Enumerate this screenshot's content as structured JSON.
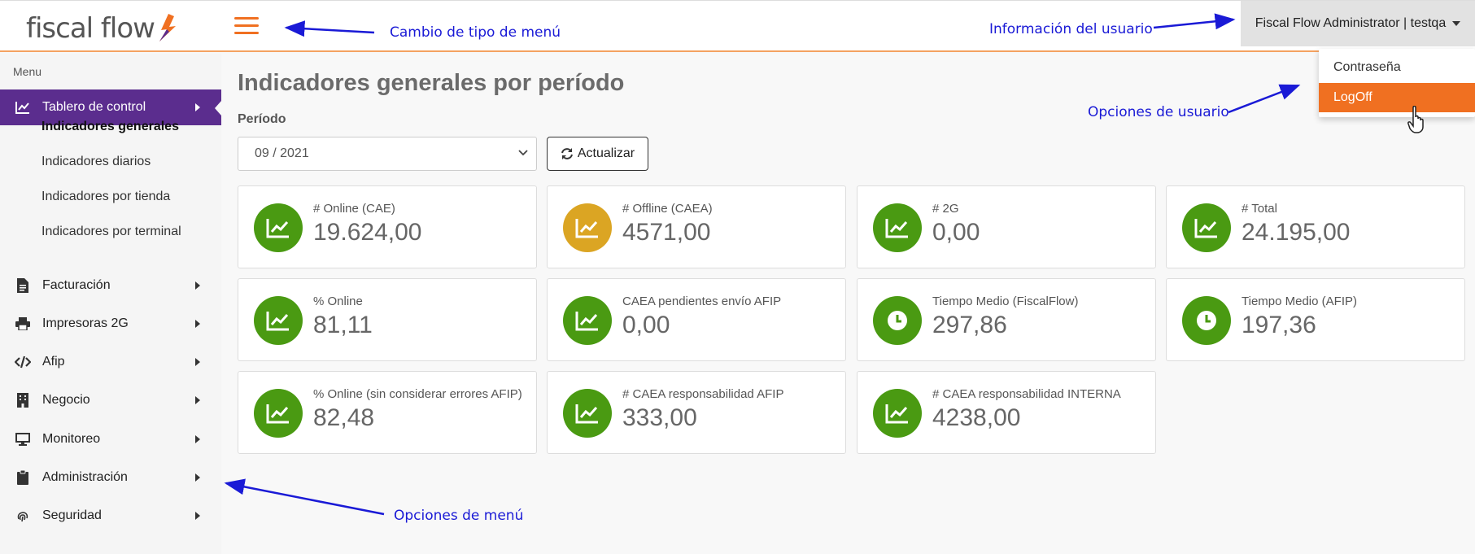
{
  "header": {
    "logo_text": "fiscal flow",
    "user_label": "Fiscal Flow Administrator | testqa",
    "dropdown": [
      "Contraseña",
      "LogOff"
    ]
  },
  "sidebar": {
    "menu_label": "Menu",
    "items": [
      {
        "label": "Tablero de control",
        "icon": "chart-line-icon"
      },
      {
        "label": "Facturación",
        "icon": "document-icon"
      },
      {
        "label": "Impresoras 2G",
        "icon": "printer-icon"
      },
      {
        "label": "Afip",
        "icon": "code-icon"
      },
      {
        "label": "Negocio",
        "icon": "building-icon"
      },
      {
        "label": "Monitoreo",
        "icon": "monitor-icon"
      },
      {
        "label": "Administración",
        "icon": "clipboard-icon"
      },
      {
        "label": "Seguridad",
        "icon": "fingerprint-icon"
      }
    ],
    "subitems": [
      "Indicadores generales",
      "Indicadores diarios",
      "Indicadores por tienda",
      "Indicadores por terminal"
    ]
  },
  "main": {
    "title": "Indicadores generales por período",
    "period_label": "Período",
    "period_value": "09 / 2021",
    "refresh_label": "Actualizar",
    "cards": [
      {
        "label": "# Online (CAE)",
        "value": "19.624,00",
        "color": "#4a9a12",
        "icon": "chart-area-icon"
      },
      {
        "label": "# Offline (CAEA)",
        "value": "4571,00",
        "color": "#dba523",
        "icon": "chart-area-icon"
      },
      {
        "label": "# 2G",
        "value": "0,00",
        "color": "#4a9a12",
        "icon": "chart-area-icon"
      },
      {
        "label": "# Total",
        "value": "24.195,00",
        "color": "#4a9a12",
        "icon": "chart-area-icon"
      },
      {
        "label": "% Online",
        "value": "81,11",
        "color": "#4a9a12",
        "icon": "chart-area-icon"
      },
      {
        "label": "CAEA pendientes envío AFIP",
        "value": "0,00",
        "color": "#4a9a12",
        "icon": "chart-area-icon"
      },
      {
        "label": "Tiempo Medio (FiscalFlow)",
        "value": "297,86",
        "color": "#4a9a12",
        "icon": "clock-icon"
      },
      {
        "label": "Tiempo Medio (AFIP)",
        "value": "197,36",
        "color": "#4a9a12",
        "icon": "clock-icon"
      },
      {
        "label": "% Online (sin considerar errores AFIP)",
        "value": "82,48",
        "color": "#4a9a12",
        "icon": "chart-area-icon"
      },
      {
        "label": "# CAEA responsabilidad AFIP",
        "value": "333,00",
        "color": "#4a9a12",
        "icon": "chart-area-icon"
      },
      {
        "label": "# CAEA responsabilidad INTERNA",
        "value": "4238,00",
        "color": "#4a9a12",
        "icon": "chart-area-icon"
      }
    ]
  },
  "annotations": {
    "menu_type": "Cambio de tipo de menú",
    "user_info": "Información del usuario",
    "user_options": "Opciones de usuario",
    "menu_options": "Opciones de menú"
  },
  "colors": {
    "accent": "#f07021",
    "nav_active": "#5b2d8e",
    "annotation": "#1a1ad6"
  }
}
